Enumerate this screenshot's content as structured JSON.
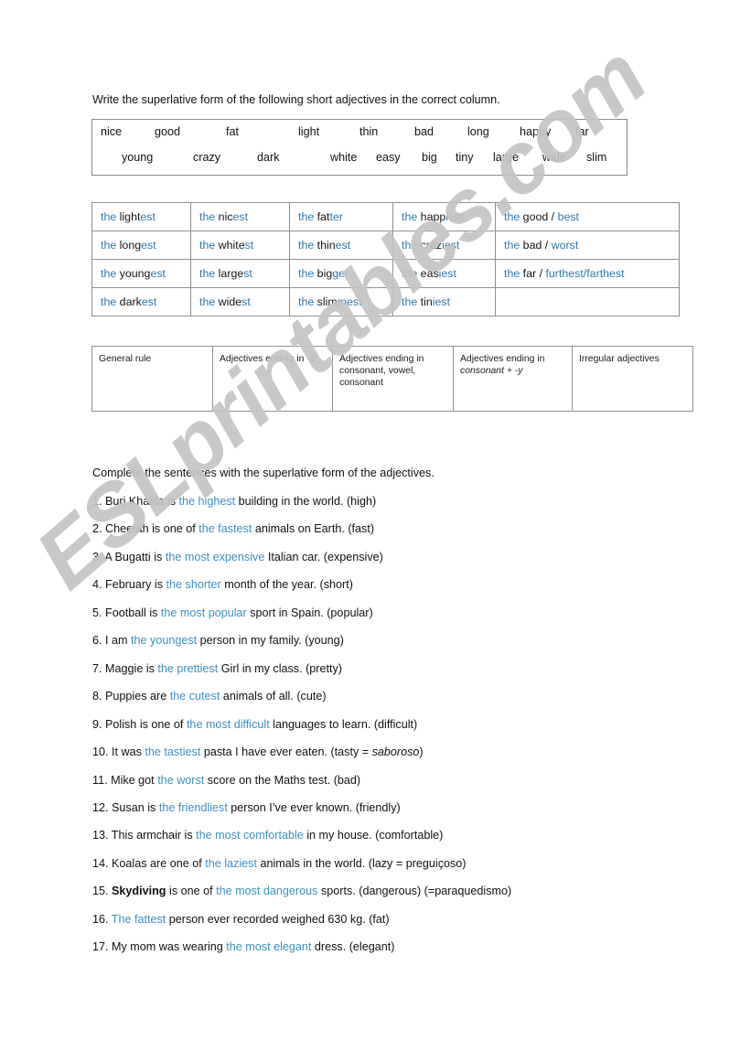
{
  "worksheet": {
    "instruction_1": "Write the superlative form of the following short adjectives in the correct column.",
    "instruction_2": "Complete the sentences with the superlative form of the adjectives."
  },
  "word_bank": {
    "row1": [
      "nice",
      "good",
      "fat",
      "light",
      "thin",
      "bad",
      "long",
      "happy",
      "far"
    ],
    "row2": [
      "young",
      "crazy",
      "dark",
      "white",
      "easy",
      "big",
      "tiny",
      "large",
      "wide",
      "slim"
    ]
  },
  "answers_table": {
    "rows": [
      [
        {
          "the": "the ",
          "stem": "light",
          "suffix": "est"
        },
        {
          "the": "the ",
          "stem": "nic",
          "suffix": "est"
        },
        {
          "the": "the ",
          "stem": "fat",
          "suffix": "ter"
        },
        {
          "the": "the ",
          "stem": "happ",
          "suffix": "iest"
        },
        {
          "the": "the ",
          "stem": "good / ",
          "suffix": "best",
          "irregular": true
        }
      ],
      [
        {
          "the": "the ",
          "stem": "long",
          "suffix": "est"
        },
        {
          "the": "the ",
          "stem": "white",
          "suffix": "st"
        },
        {
          "the": "the ",
          "stem": "thin",
          "suffix": "est"
        },
        {
          "the": "the ",
          "stem": "craz",
          "suffix": "iest"
        },
        {
          "the": "the ",
          "stem": "bad / ",
          "suffix": "worst",
          "irregular": true
        }
      ],
      [
        {
          "the": "the ",
          "stem": "young",
          "suffix": "est"
        },
        {
          "the": "the ",
          "stem": "large",
          "suffix": "st"
        },
        {
          "the": "the ",
          "stem": "big",
          "suffix": "ger"
        },
        {
          "the": "the ",
          "stem": "eas",
          "suffix": "iest"
        },
        {
          "the": "the ",
          "stem": "far / ",
          "suffix": "furthest/farthest",
          "irregular": true
        }
      ],
      [
        {
          "the": "the ",
          "stem": "dark",
          "suffix": "est"
        },
        {
          "the": "the ",
          "stem": "wide",
          "suffix": "st"
        },
        {
          "the": "the ",
          "stem": "slim",
          "suffix": "mest"
        },
        {
          "the": "the ",
          "stem": "tin",
          "suffix": "iest"
        },
        {
          "the": "",
          "stem": "",
          "suffix": "",
          "empty": true
        }
      ]
    ]
  },
  "rules_table": {
    "headers": [
      {
        "plain": "General rule",
        "italic": "",
        "plain2": ""
      },
      {
        "plain": "Adjectives ending in ",
        "italic": "-e",
        "plain2": ""
      },
      {
        "plain": "Adjectives ending in consonant, vowel, consonant",
        "italic": "",
        "plain2": ""
      },
      {
        "plain": "Adjectives ending in ",
        "italic": "consonant + -y",
        "plain2": ""
      },
      {
        "plain": "Irregular adjectives",
        "italic": "",
        "plain2": ""
      }
    ]
  },
  "sentences": [
    {
      "num": "1. ",
      "pre": "Burj Khalifa is ",
      "answer": "the highest",
      "post": " building in the world. (high)"
    },
    {
      "num": "2. ",
      "pre": "Cheetah is one of ",
      "answer": "the fastest",
      "post": " animals on Earth. (fast)"
    },
    {
      "num": "3. ",
      "pre": "A Bugatti is ",
      "answer": "the most expensive",
      "post": " Italian car. (expensive)"
    },
    {
      "num": "4. ",
      "pre": "February is ",
      "answer": "the shorter",
      "post": " month of the year. (short)"
    },
    {
      "num": "5. ",
      "pre": "Football is ",
      "answer": "the most popular",
      "post": " sport in Spain. (popular)"
    },
    {
      "num": "6. ",
      "pre": "I am ",
      "answer": "the youngest",
      "post": " person in my family. (young)"
    },
    {
      "num": "7. ",
      "pre": "Maggie is ",
      "answer": "the prettiest",
      "post": " Girl in my class. (pretty)"
    },
    {
      "num": "8. ",
      "pre": "Puppies are ",
      "answer": "the cutest",
      "post": " animals of all. (cute)"
    },
    {
      "num": "9. ",
      "pre": "Polish is one of ",
      "answer": "the most difficult",
      "post": " languages to learn. (difficult)"
    },
    {
      "num": "10. ",
      "pre": "It was ",
      "answer": "the tastiest",
      "post": " pasta I have ever eaten. (tasty = ",
      "italic": "saboroso",
      "post2": ")"
    },
    {
      "num": "11. ",
      "pre": "Mike got ",
      "answer": "the worst",
      "post": " score on the Maths test. (bad)"
    },
    {
      "num": "12. ",
      "pre": "Susan is ",
      "answer": "the friendliest",
      "post": " person I’ve ever known. (friendly)"
    },
    {
      "num": "13. ",
      "pre": "This armchair is ",
      "answer": "the most comfortable",
      "post": " in my house. (comfortable)"
    },
    {
      "num": "14. ",
      "pre": "Koalas are one of ",
      "answer": "the laziest",
      "post": " animals in the world. (lazy = preguiçoso)"
    },
    {
      "num": "15. ",
      "bold": "Skydiving",
      "pre": " is one of ",
      "answer": "the most dangerous",
      "post": " sports. (dangerous) (=paraquedismo)"
    },
    {
      "num": "16. ",
      "pre": "",
      "answer": "The fattest",
      "post": " person ever recorded weighed 630 kg. (fat)"
    },
    {
      "num": "17. ",
      "pre": "My mom was wearing ",
      "answer": "the most elegant",
      "post": " dress. (elegant)"
    }
  ],
  "watermark": {
    "text": "ESLprintables.com"
  },
  "colors": {
    "answer_blue": "#3f8fc4",
    "table_blue": "#2f78ad",
    "text_dark": "#111111",
    "border_gray": "#8f8f8f",
    "watermark_gray": "#c4c4c4"
  }
}
